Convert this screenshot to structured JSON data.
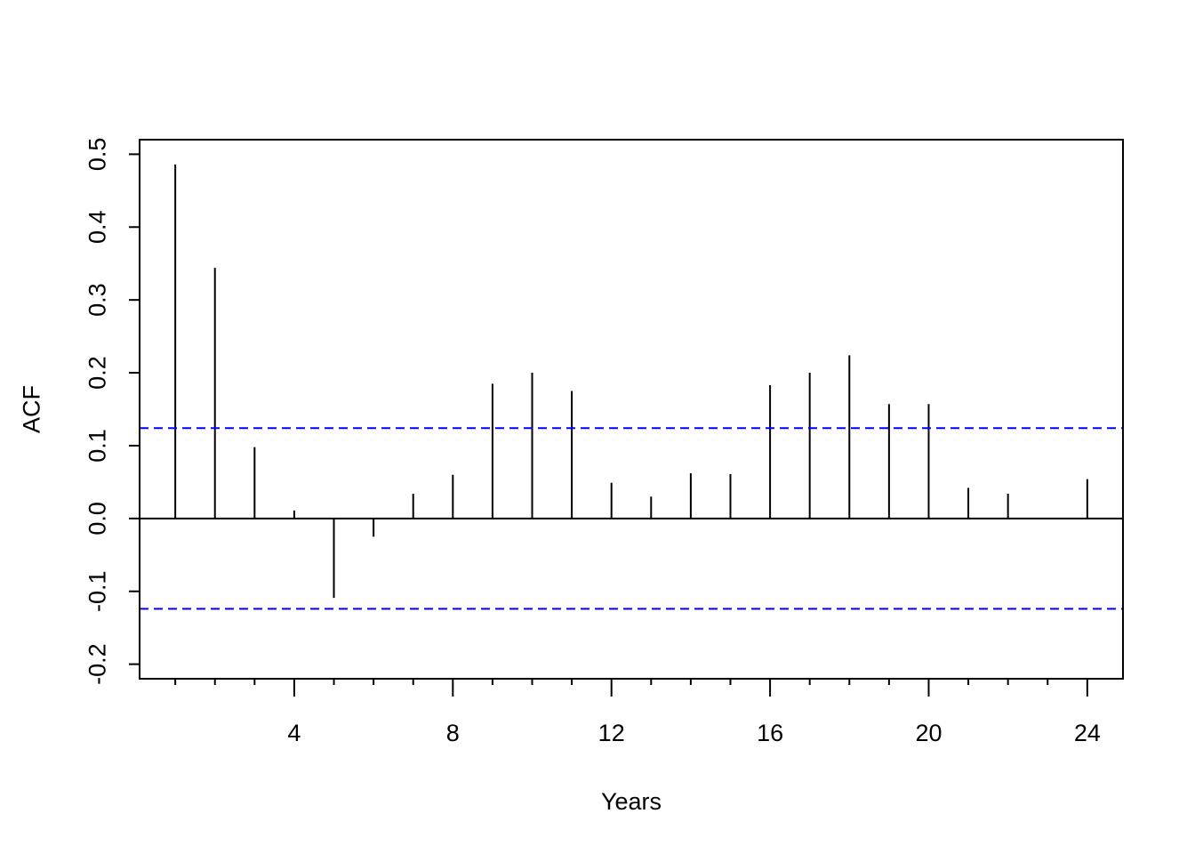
{
  "chart_data": {
    "type": "bar",
    "subtype": "acf-lollipop",
    "title": "",
    "xlabel": "Years",
    "ylabel": "ACF",
    "xlim": [
      0.1,
      24.9
    ],
    "ylim": [
      -0.22,
      0.52
    ],
    "x": [
      1,
      2,
      3,
      4,
      5,
      6,
      7,
      8,
      9,
      10,
      11,
      12,
      13,
      14,
      15,
      16,
      17,
      18,
      19,
      20,
      21,
      22,
      23,
      24
    ],
    "values": [
      0.486,
      0.344,
      0.098,
      0.011,
      -0.109,
      -0.025,
      0.034,
      0.06,
      0.185,
      0.2,
      0.175,
      0.049,
      0.03,
      0.062,
      0.061,
      0.183,
      0.2,
      0.224,
      0.157,
      0.157,
      0.042,
      0.034,
      0.0,
      0.054
    ],
    "confidence_bounds": [
      0.124,
      -0.124
    ],
    "confidence_color": "#0000ff",
    "x_major_ticks": [
      4,
      8,
      12,
      16,
      20,
      24
    ],
    "x_tick_labels": [
      "4",
      "8",
      "12",
      "16",
      "20",
      "24"
    ],
    "x_minor_ticks": [
      1,
      2,
      3,
      5,
      6,
      7,
      9,
      10,
      11,
      13,
      14,
      15,
      17,
      18,
      19,
      21,
      22,
      23
    ],
    "y_ticks": [
      -0.2,
      -0.1,
      0.0,
      0.1,
      0.2,
      0.3,
      0.4,
      0.5
    ],
    "y_tick_labels": [
      "-0.2",
      "-0.1",
      "0.0",
      "0.1",
      "0.2",
      "0.3",
      "0.4",
      "0.5"
    ],
    "grid": false,
    "legend": "none"
  }
}
